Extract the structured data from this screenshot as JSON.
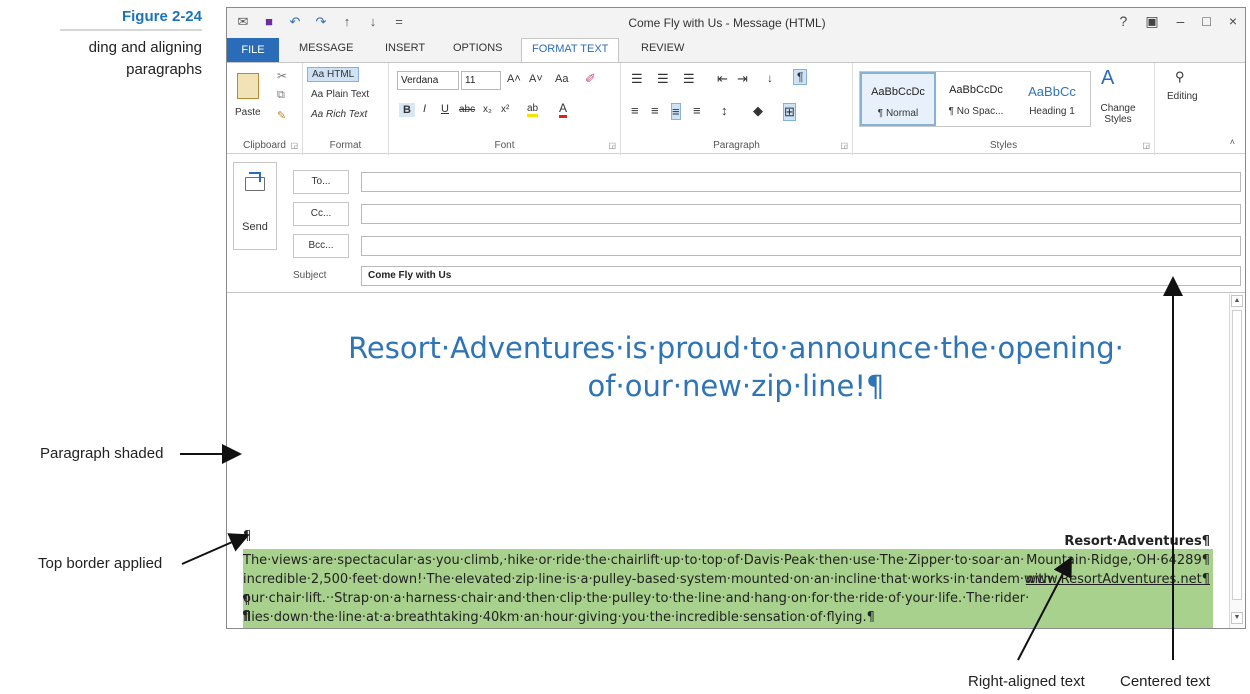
{
  "figure": {
    "number": "Figure 2-24",
    "caption": "ding and aligning\nparagraphs"
  },
  "window": {
    "title": "Come Fly with Us - Message (HTML)",
    "qat_icons": [
      "envelope-icon",
      "save-icon",
      "undo-icon",
      "redo-icon",
      "up-arrow-icon",
      "down-arrow-icon",
      "customize-icon"
    ],
    "qat_glyphs": [
      "✉",
      "■",
      "↶",
      "↷",
      "↑",
      "↓",
      "="
    ],
    "controls": {
      "help": "?",
      "restore": "▣",
      "minimize": "–",
      "maximize": "□",
      "close": "×"
    }
  },
  "tabs": [
    "FILE",
    "MESSAGE",
    "INSERT",
    "OPTIONS",
    "FORMAT TEXT",
    "REVIEW"
  ],
  "active_tab": "FORMAT TEXT",
  "ribbon": {
    "clipboard": {
      "label": "Clipboard",
      "paste": "Paste"
    },
    "format": {
      "label": "Format",
      "html": "Aa HTML",
      "plain": "Aa Plain Text",
      "rich": "Aa Rich Text"
    },
    "font": {
      "label": "Font",
      "name": "Verdana",
      "size": "11",
      "grow": "A˄",
      "shrink": "A˅",
      "case": "Aa",
      "bold": "B",
      "italic": "I",
      "underline": "U",
      "strike": "abc",
      "sub": "x₂",
      "sup": "x²",
      "highlight": "ab",
      "color": "A"
    },
    "paragraph": {
      "label": "Paragraph"
    },
    "styles": {
      "label": "Styles",
      "items": [
        {
          "sample": "AaBbCcDc",
          "name": "¶ Normal"
        },
        {
          "sample": "AaBbCcDc",
          "name": "¶ No Spac..."
        },
        {
          "sample": "AaBbCc",
          "name": "Heading 1"
        }
      ],
      "change_styles": "Change Styles"
    },
    "editing": {
      "label": "Editing"
    }
  },
  "header": {
    "send": "Send",
    "to": "To...",
    "cc": "Cc...",
    "bcc": "Bcc...",
    "subject_label": "Subject",
    "subject_value": "Come Fly with Us"
  },
  "body": {
    "headline_line1": "Resort·Adventures·is·proud·to·announce·the·opening·",
    "headline_line2": "of·our·new·zip·line!¶",
    "pilcrow": "¶",
    "paragraph": "The·views·are·spectacular·as·you·climb,·hike·or·ride·the·chairlift·up·to·top·of·Davis·Peak·then·use·The·Zipper·to·soar·an·\nincredible·2,500·feet·down!·The·elevated·zip·line·is·a·pulley-based·system·mounted·on·an·incline·that·works·in·tandem·with·\nour·chair·lift.··Strap·on·a·harness·chair·and·then·clip·the·pulley·to·the·line·and·hang·on·for·the·ride·of·your·life.·The·rider·\nflies·down·the·line·at·a·breathtaking·40km·an·hour·giving·you·the·incredible·sensation·of·flying.¶",
    "signature": [
      "Resort·Adventures¶",
      "Mountain·Ridge,·OH·64289¶",
      "www.ResortAdventures.net¶"
    ]
  },
  "annotations": {
    "shaded": "Paragraph shaded",
    "border": "Top border applied",
    "right_aligned": "Right-aligned text",
    "centered": "Centered text"
  },
  "colors": {
    "accent": "#2b6cb8",
    "headline": "#2f75b5",
    "shading": "#a9d18e",
    "figure_title": "#1b74b8"
  }
}
